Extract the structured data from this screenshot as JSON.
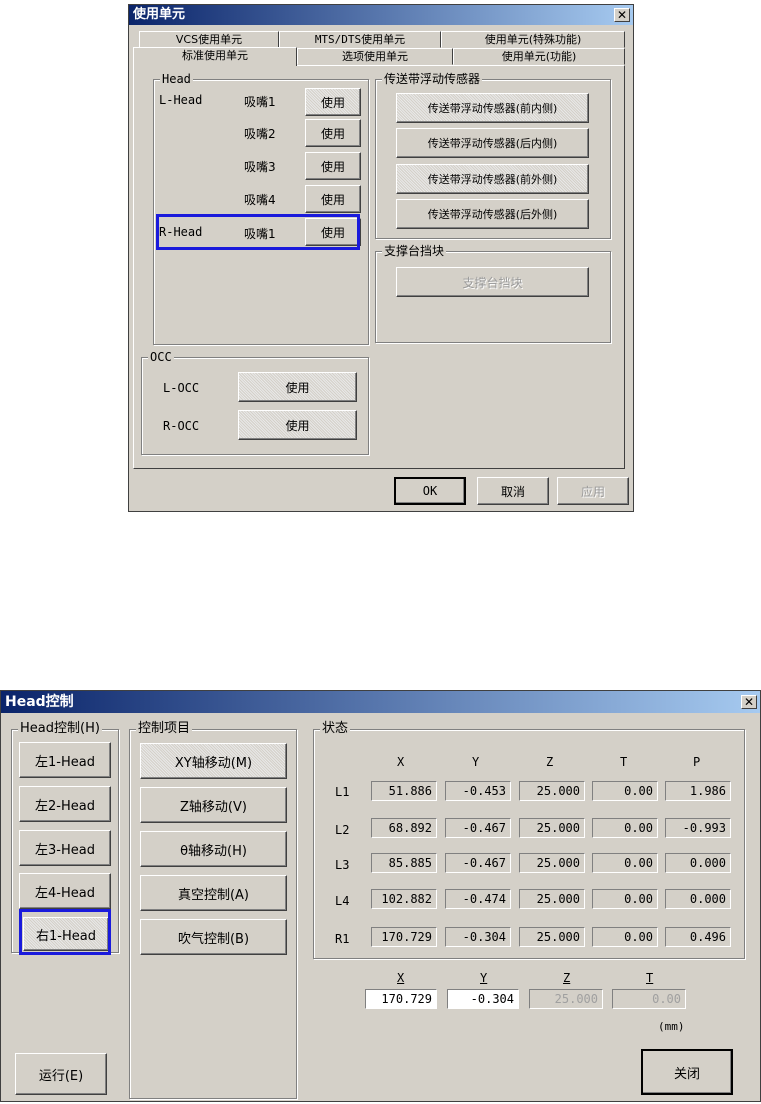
{
  "dialog1": {
    "title": "使用单元",
    "tabs_row1": [
      "VCS使用单元",
      "MTS/DTS使用单元",
      "使用单元(特殊功能)"
    ],
    "tabs_row2": [
      "标准使用单元",
      "选项使用单元",
      "使用单元(功能)"
    ],
    "head_group": "Head",
    "l_head": "L-Head",
    "r_head": "R-Head",
    "nozzles": [
      "吸嘴1",
      "吸嘴2",
      "吸嘴3",
      "吸嘴4",
      "吸嘴1"
    ],
    "use_label": "使用",
    "conveyor_group": "传送带浮动传感器",
    "conveyor_buttons": [
      "传送带浮动传感器(前内侧)",
      "传送带浮动传感器(后内侧)",
      "传送带浮动传感器(前外侧)",
      "传送带浮动传感器(后外侧)"
    ],
    "support_group": "支撑台挡块",
    "support_button": "支撑台挡块",
    "occ_group": "OCC",
    "l_occ": "L-OCC",
    "r_occ": "R-OCC",
    "ok": "OK",
    "cancel": "取消",
    "apply": "应用"
  },
  "dialog2": {
    "title": "Head控制",
    "head_group": "Head控制(H)",
    "head_buttons": [
      "左1-Head",
      "左2-Head",
      "左3-Head",
      "左4-Head",
      "右1-Head"
    ],
    "control_group": "控制项目",
    "control_buttons": [
      "XY轴移动(M)",
      "Z轴移动(V)",
      "θ轴移动(H)",
      "真空控制(A)",
      "吹气控制(B)"
    ],
    "status_group": "状态",
    "columns": [
      "X",
      "Y",
      "Z",
      "T",
      "P"
    ],
    "rows": [
      {
        "label": "L1",
        "values": [
          "51.886",
          "-0.453",
          "25.000",
          "0.00",
          "1.986"
        ]
      },
      {
        "label": "L2",
        "values": [
          "68.892",
          "-0.467",
          "25.000",
          "0.00",
          "-0.993"
        ]
      },
      {
        "label": "L3",
        "values": [
          "85.885",
          "-0.467",
          "25.000",
          "0.00",
          "0.000"
        ]
      },
      {
        "label": "L4",
        "values": [
          "102.882",
          "-0.474",
          "25.000",
          "0.00",
          "0.000"
        ]
      },
      {
        "label": "R1",
        "values": [
          "170.729",
          "-0.304",
          "25.000",
          "0.00",
          "0.496"
        ]
      }
    ],
    "input_labels": [
      "X",
      "Y",
      "Z",
      "T"
    ],
    "inputs": [
      "170.729",
      "-0.304",
      "25.000",
      "0.00"
    ],
    "unit": "(mm)",
    "run": "运行(E)",
    "close": "关闭"
  },
  "colors": {
    "highlight": "#1a1adc",
    "title_start": "#0a246a",
    "face": "#d4d0c8"
  }
}
